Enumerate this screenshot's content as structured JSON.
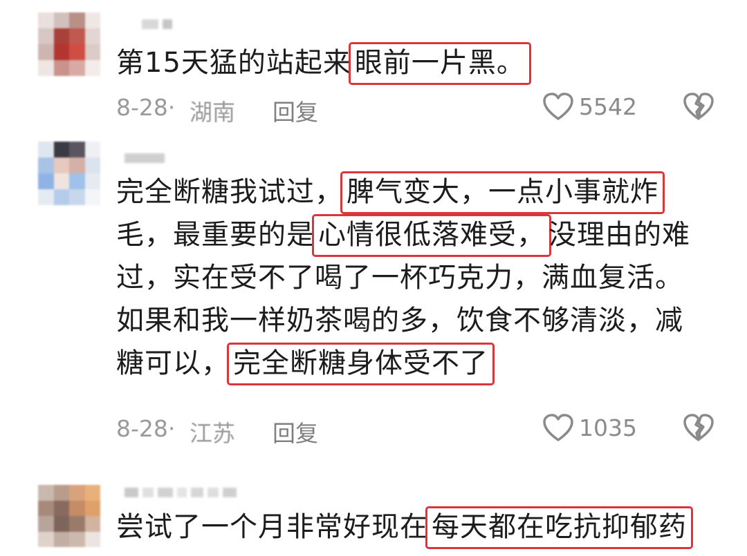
{
  "comments": [
    {
      "pre": "第15天猛的站起来",
      "hl1": "眼前一片黑。",
      "date": "8-28·",
      "location": "湖南",
      "reply": "回复",
      "likes": "5542"
    },
    {
      "line1_pre": "完全断糖我试过，",
      "line1_hl": "脾气变大，一点小事就炸",
      "line2_pre": "毛，最重要的是",
      "line2_hl": "心情很低落难受，",
      "line2_post": "没理由的难",
      "line3": "过，实在受不了喝了一杯巧克力，满血复活。",
      "line4": "如果和我一样奶茶喝的多，饮食不够清淡，减",
      "line5_pre": "糖可以，",
      "line5_hl": "完全断糖身体受不了",
      "date": "8-28·",
      "location": "江苏",
      "reply": "回复",
      "likes": "1035"
    },
    {
      "pre": "尝试了一个月非常好现在",
      "hl1": "每天都在吃抗抑郁药"
    }
  ],
  "icons": {
    "like": "heart-outline-icon",
    "dislike": "broken-heart-icon"
  },
  "colors": {
    "highlight_border": "#d9363a",
    "meta_text": "#9a9a9a"
  }
}
